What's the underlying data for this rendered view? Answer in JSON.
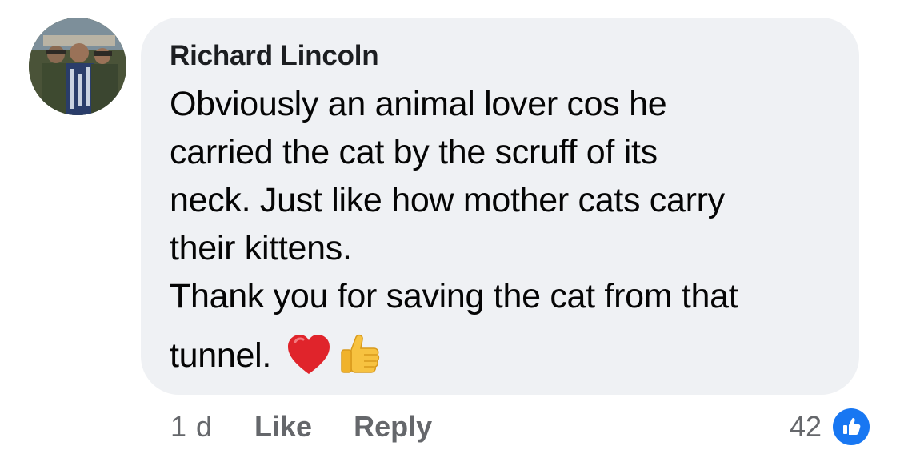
{
  "comment": {
    "author": "Richard Lincoln",
    "lines": [
      "Obviously an animal lover cos he",
      "carried the cat by the scruff of its",
      "neck. Just like how mother cats carry",
      "their kittens.",
      "Thank you for saving the cat from that"
    ],
    "last_line": "tunnel.",
    "emojis": [
      "red-heart",
      "thumbs-up"
    ]
  },
  "actions": {
    "timestamp": "1 d",
    "like_label": "Like",
    "reply_label": "Reply"
  },
  "reactions": {
    "count": "42",
    "icon": "like-icon",
    "color": "#1877f2"
  },
  "colors": {
    "bubble": "#eff1f4",
    "text": "#050505",
    "meta": "#65676b"
  }
}
